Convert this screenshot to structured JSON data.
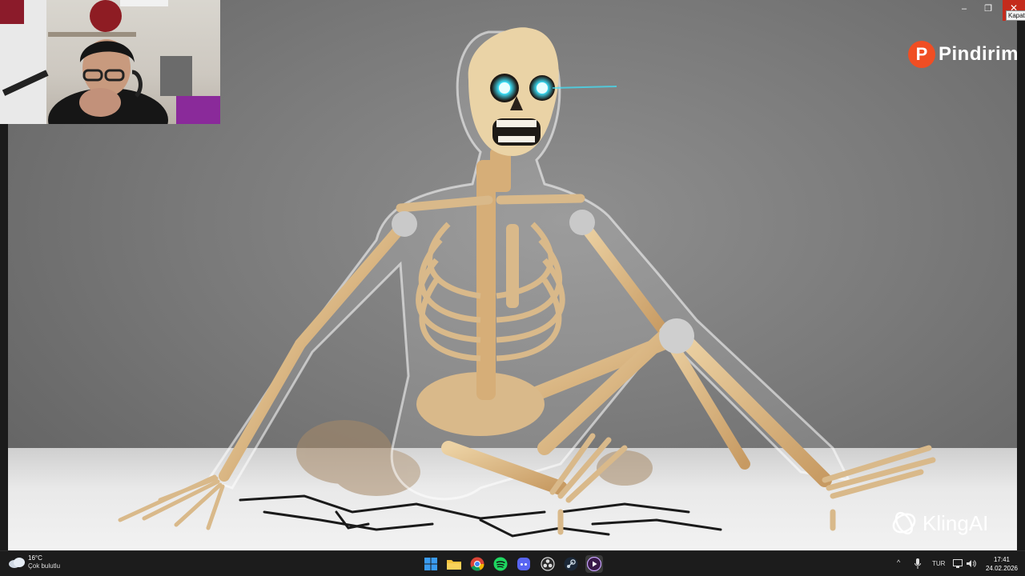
{
  "window": {
    "minimize_glyph": "–",
    "maximize_glyph": "❐",
    "close_glyph": "✕",
    "close_tooltip": "Kapat"
  },
  "overlay": {
    "brand_badge_letter": "P",
    "brand_name": "Pindirim",
    "watermark": "KlingAI"
  },
  "taskbar": {
    "weather_temp": "16°C",
    "weather_desc": "Çok bulutlu",
    "apps": [
      {
        "name": "windows-start",
        "icon": "windows-logo-icon"
      },
      {
        "name": "file-explorer",
        "icon": "folder-icon"
      },
      {
        "name": "chrome",
        "icon": "chrome-icon"
      },
      {
        "name": "spotify",
        "icon": "spotify-icon"
      },
      {
        "name": "discord",
        "icon": "discord-icon"
      },
      {
        "name": "obs",
        "icon": "obs-icon"
      },
      {
        "name": "steam",
        "icon": "steam-icon"
      },
      {
        "name": "media-player",
        "icon": "play-icon"
      }
    ],
    "tray_chevron": "^",
    "language": "TUR",
    "time": "17:41",
    "date": "24.02.2026"
  },
  "colors": {
    "close_red": "#c42b1c",
    "brand_orange": "#f04e23",
    "eye_glow": "#3fe6ff",
    "bone": "#d9b98a"
  }
}
